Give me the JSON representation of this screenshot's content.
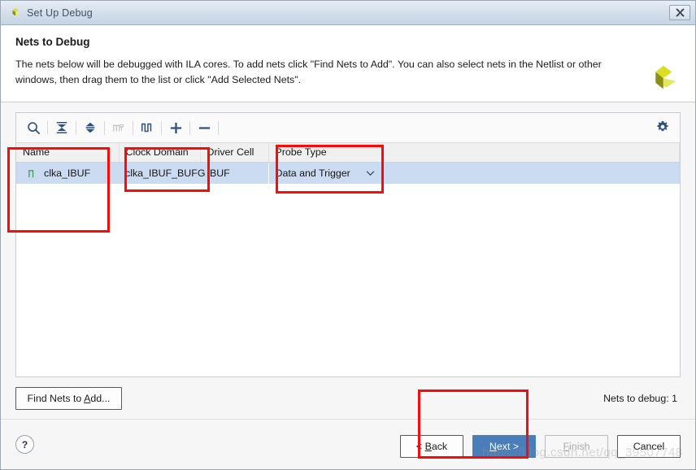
{
  "window": {
    "title": "Set Up Debug",
    "close_label": "✕",
    "app_icon": "xilinx-logo-icon"
  },
  "header": {
    "title": "Nets to Debug",
    "description_line1": "The nets below will be debugged with ILA cores. To add nets click \"Find Nets to Add\". You can also select nets in the Netlist or other",
    "description_line2": "windows, then drag them to the list or click \"Add Selected Nets\".",
    "logo": "xilinx-logo-icon"
  },
  "toolbar": {
    "buttons": [
      {
        "name": "search-icon",
        "enabled": true
      },
      {
        "name": "collapse-all-icon",
        "enabled": true
      },
      {
        "name": "expand-all-icon",
        "enabled": true
      },
      {
        "name": "clock-domain-icon",
        "enabled": false
      },
      {
        "name": "waveform-icon",
        "enabled": true
      },
      {
        "name": "add-icon",
        "enabled": true
      },
      {
        "name": "remove-icon",
        "enabled": true
      }
    ],
    "settings": "gear-icon"
  },
  "table": {
    "columns": [
      "Name",
      "Clock Domain",
      "Driver Cell",
      "Probe Type"
    ],
    "rows": [
      {
        "name": "clka_IBUF",
        "clock_domain": "clka_IBUF_BUFG",
        "driver_cell": "IBUF",
        "probe_type": "Data and Trigger",
        "icon": "clock-waveform-icon",
        "selected": true
      }
    ]
  },
  "actions": {
    "find_nets_prefix": "Find Nets to ",
    "find_nets_accel": "A",
    "find_nets_suffix": "dd...",
    "nets_to_debug": "Nets to debug: 1"
  },
  "footer": {
    "help": "?",
    "back_prefix": "< ",
    "back_accel": "B",
    "back_suffix": "ack",
    "next_accel": "N",
    "next_suffix": "ext >",
    "finish_accel": "F",
    "finish_suffix": "inish",
    "cancel": "Cancel"
  },
  "watermark": "https://blog.csdn.net/qq_39507748",
  "colors": {
    "accent": "#4a7ebb",
    "annotation": "#fb0a0a",
    "selection": "#cbdcf2",
    "logo_light": "#d9e021",
    "logo_dark": "#8a8f15"
  }
}
